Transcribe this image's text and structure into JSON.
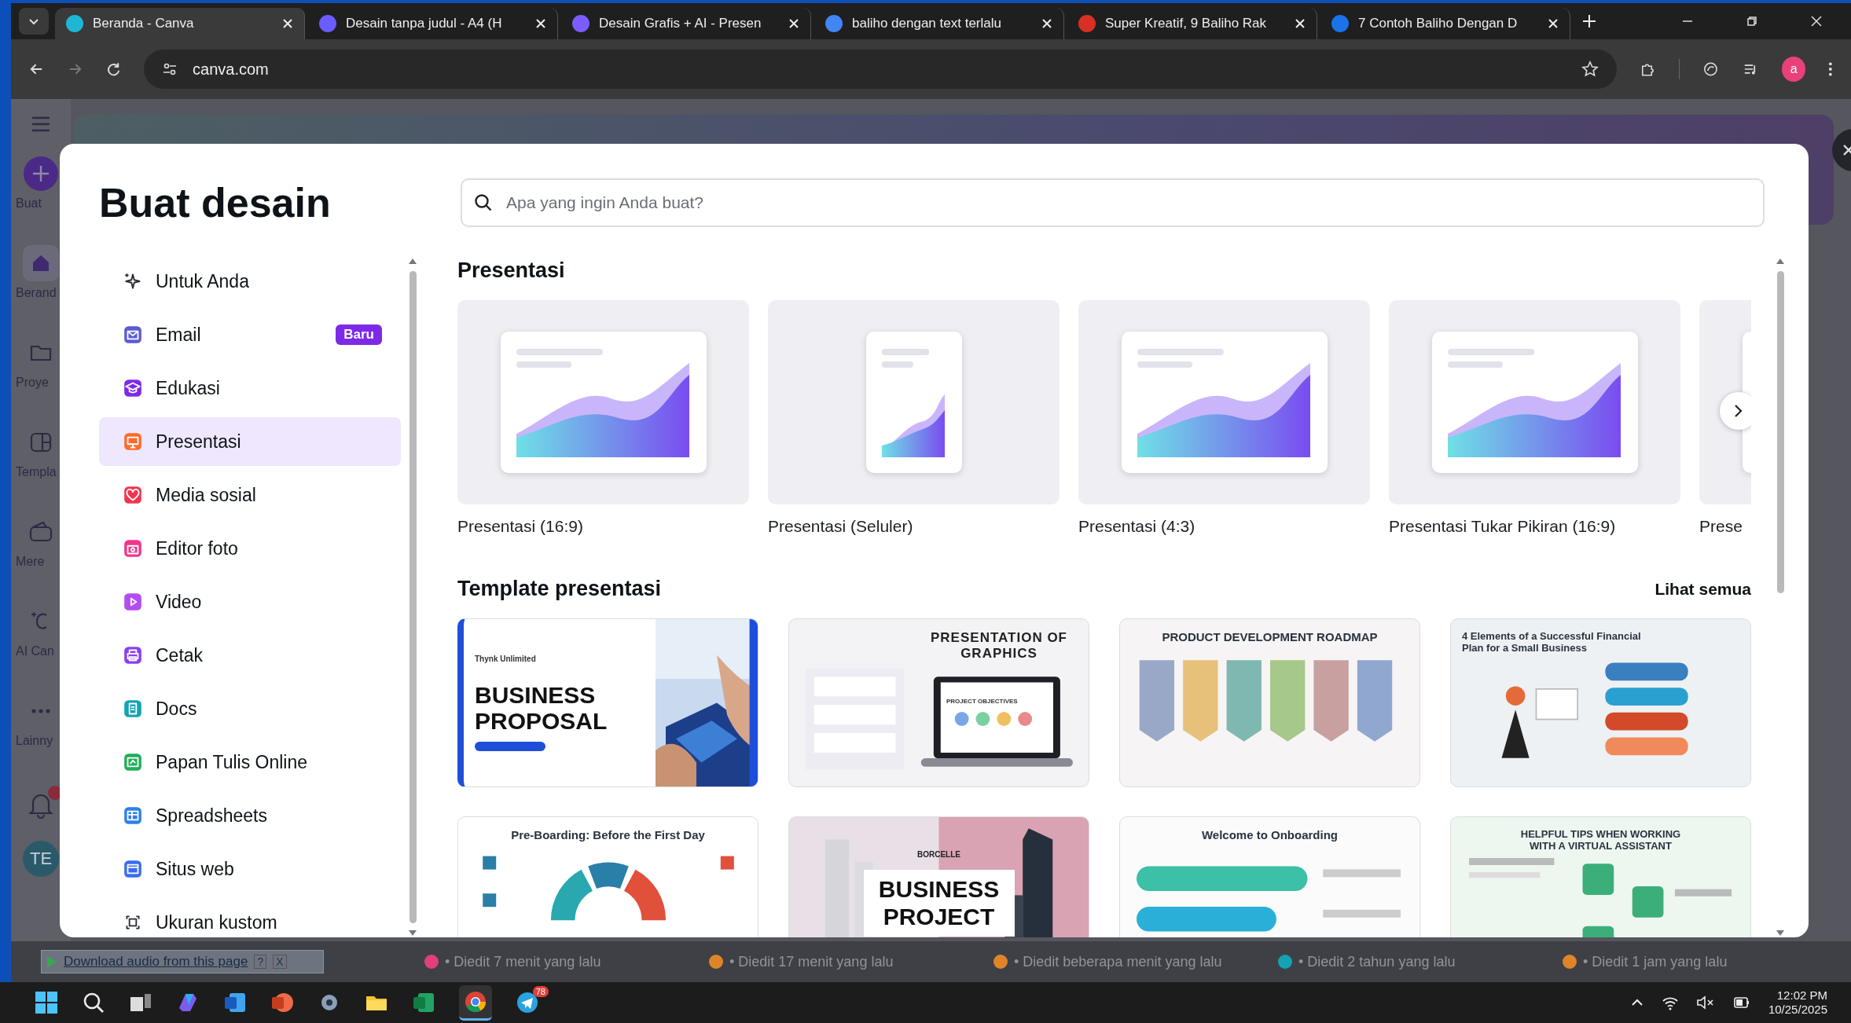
{
  "browser": {
    "tabs": [
      {
        "title": "Beranda - Canva",
        "selected": true,
        "color": "#1fb6d6"
      },
      {
        "title": "Desain tanpa judul - A4 (H",
        "selected": false,
        "color": "#6a5cff"
      },
      {
        "title": "Desain Grafis + AI - Presen",
        "selected": false,
        "color": "#7c5cff"
      },
      {
        "title": "baliho dengan text terlalu",
        "selected": false,
        "color": "#4285f4"
      },
      {
        "title": "Super Kreatif, 9 Baliho Rak",
        "selected": false,
        "color": "#d93025"
      },
      {
        "title": "7 Contoh Baliho Dengan D",
        "selected": false,
        "color": "#1a73e8"
      }
    ],
    "address": "canva.com",
    "profile": "a"
  },
  "app_rail": {
    "items": [
      {
        "label": "Buat"
      },
      {
        "label": "Berand"
      },
      {
        "label": "Proye"
      },
      {
        "label": "Templa"
      },
      {
        "label": "Mere"
      },
      {
        "label": "AI Can"
      },
      {
        "label": "Lainny"
      }
    ],
    "avatar": "TE"
  },
  "dialog": {
    "title": "Buat desain",
    "search_placeholder": "Apa yang ingin Anda buat?",
    "categories": [
      {
        "label": "Untuk Anda",
        "selected": false,
        "color": "#2b2b35"
      },
      {
        "label": "Email",
        "selected": false,
        "color": "#5b5bd6",
        "badge": "Baru"
      },
      {
        "label": "Edukasi",
        "selected": false,
        "color": "#7d2ae8"
      },
      {
        "label": "Presentasi",
        "selected": true,
        "color": "#ff6a2b"
      },
      {
        "label": "Media sosial",
        "selected": false,
        "color": "#f0364f"
      },
      {
        "label": "Editor foto",
        "selected": false,
        "color": "#f0368a"
      },
      {
        "label": "Video",
        "selected": false,
        "color": "#b44cf0"
      },
      {
        "label": "Cetak",
        "selected": false,
        "color": "#8b3ef0"
      },
      {
        "label": "Docs",
        "selected": false,
        "color": "#13a3b5"
      },
      {
        "label": "Papan Tulis Online",
        "selected": false,
        "color": "#1fae5b"
      },
      {
        "label": "Spreadsheets",
        "selected": false,
        "color": "#2f80ed"
      },
      {
        "label": "Situs web",
        "selected": false,
        "color": "#3b6cf0"
      },
      {
        "label": "Ukuran kustom",
        "selected": false,
        "color": "#2b2b35"
      }
    ],
    "presentation_section": {
      "heading": "Presentasi",
      "formats": [
        {
          "label": "Presentasi (16:9)",
          "kind": "wide"
        },
        {
          "label": "Presentasi (Seluler)",
          "kind": "phone"
        },
        {
          "label": "Presentasi (4:3)",
          "kind": "wide"
        },
        {
          "label": "Presentasi Tukar Pikiran (16:9)",
          "kind": "wide"
        },
        {
          "label": "Prese",
          "kind": "wide"
        }
      ]
    },
    "template_section": {
      "heading": "Template presentasi",
      "link": "Lihat semua",
      "templates": [
        {
          "kind": "proposal",
          "title": "BUSINESS PROPOSAL",
          "caption": "Thynk Unlimited"
        },
        {
          "kind": "graphics",
          "title": "PRESENTATION OF GRAPHICS",
          "caption": "PROJECT OBJECTIVES"
        },
        {
          "kind": "roadmap",
          "title": "PRODUCT DEVELOPMENT ROADMAP"
        },
        {
          "kind": "financial",
          "title": "4 Elements of a Successful Financial Plan for a Small Business"
        },
        {
          "kind": "preboarding",
          "title": "Pre-Boarding: Before the First Day"
        },
        {
          "kind": "project",
          "title": "BUSINESS PROJECT",
          "caption": "BORCELLE"
        },
        {
          "kind": "onboarding",
          "title": "Welcome to Onboarding"
        },
        {
          "kind": "tips",
          "title": "HELPFUL TIPS WHEN WORKING WITH A VIRTUAL ASSISTANT"
        }
      ]
    }
  },
  "download_bar": {
    "label": "Download audio from this page",
    "help": "?",
    "close": "X"
  },
  "recent_edits": [
    {
      "text": "• Diedit 7 menit yang lalu",
      "color": "#e0407a"
    },
    {
      "text": "• Diedit 17 menit yang lalu",
      "color": "#e0842a"
    },
    {
      "text": "• Diedit beberapa menit yang lalu",
      "color": "#e0842a"
    },
    {
      "text": "• Diedit 2 tahun yang lalu",
      "color": "#13a3b5"
    },
    {
      "text": "• Diedit 1 jam yang lalu",
      "color": "#e0842a"
    }
  ],
  "taskbar": {
    "telegram_badge": "78",
    "time": "12:02 PM",
    "date": "10/25/2025"
  }
}
